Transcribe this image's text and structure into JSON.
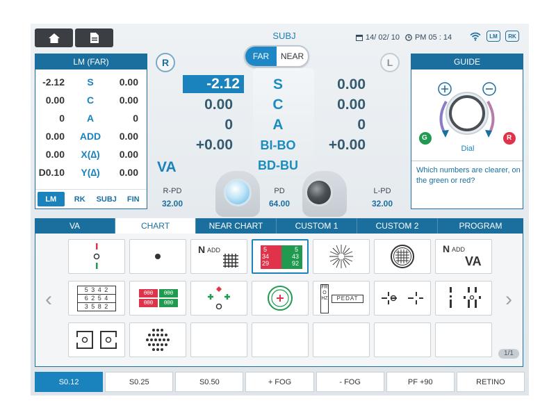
{
  "header": {
    "title": "SUBJ",
    "far_label": "FAR",
    "near_label": "NEAR",
    "date": "14/ 02/ 10",
    "time": "PM  05 : 14",
    "tag_lm": "LM",
    "tag_rk": "RK"
  },
  "lm_panel": {
    "title": "LM (FAR)",
    "rows": [
      {
        "left": "-2.12",
        "label": "S",
        "right": "0.00"
      },
      {
        "left": "0.00",
        "label": "C",
        "right": "0.00"
      },
      {
        "left": "0",
        "label": "A",
        "right": "0"
      },
      {
        "left": "0.00",
        "label": "ADD",
        "right": "0.00"
      },
      {
        "left": "0.00",
        "label": "X(∆)",
        "right": "0.00"
      },
      {
        "left": "D0.10",
        "label": "Y(∆)",
        "right": "0.00"
      }
    ],
    "tabs": [
      "LM",
      "RK",
      "SUBJ",
      "FIN"
    ]
  },
  "eyes": {
    "right": "R",
    "left": "L"
  },
  "refraction": {
    "right": [
      "-2.12",
      "0.00",
      "0",
      "+0.00"
    ],
    "left": [
      "0.00",
      "0.00",
      "0",
      "+0.00"
    ],
    "labels": [
      "S",
      "C",
      "A",
      "BI-BO",
      "BD-BU"
    ],
    "va": "VA"
  },
  "pd": {
    "r_label": "R-PD",
    "r_value": "32.00",
    "center_label": "PD",
    "center_value": "64.00",
    "l_label": "L-PD",
    "l_value": "32.00"
  },
  "guide": {
    "title": "GUIDE",
    "dial": "Dial",
    "green": "G",
    "red": "R",
    "question": "Which numbers are clearer, on the green or red?"
  },
  "tabs": [
    "VA",
    "CHART",
    "NEAR CHART",
    "CUSTOM 1",
    "CUSTOM 2",
    "PROGRAM"
  ],
  "chart_text": {
    "nadd": "N",
    "nadd_sub": "ADD",
    "nadd_va": "VA",
    "num_rows": [
      "5 3 4 2",
      "6 2 5 4",
      "3 5 8 2"
    ],
    "rg_top_left": "5",
    "rg_top_right": "5",
    "rg_mid_left": "34",
    "rg_mid_right": "43",
    "rg_bot_left": "29",
    "rg_bot_right": "92",
    "color_pairs": [
      "θθθ",
      "θθθ",
      "θθθ",
      "θθθ"
    ],
    "vertical_word": "FROHZ",
    "horizontal_word": "PEDAT"
  },
  "page_indicator": "1/1",
  "bottom": [
    "S0.12",
    "S0.25",
    "S0.50",
    "+ FOG",
    "- FOG",
    "PF +90",
    "RETINO"
  ]
}
